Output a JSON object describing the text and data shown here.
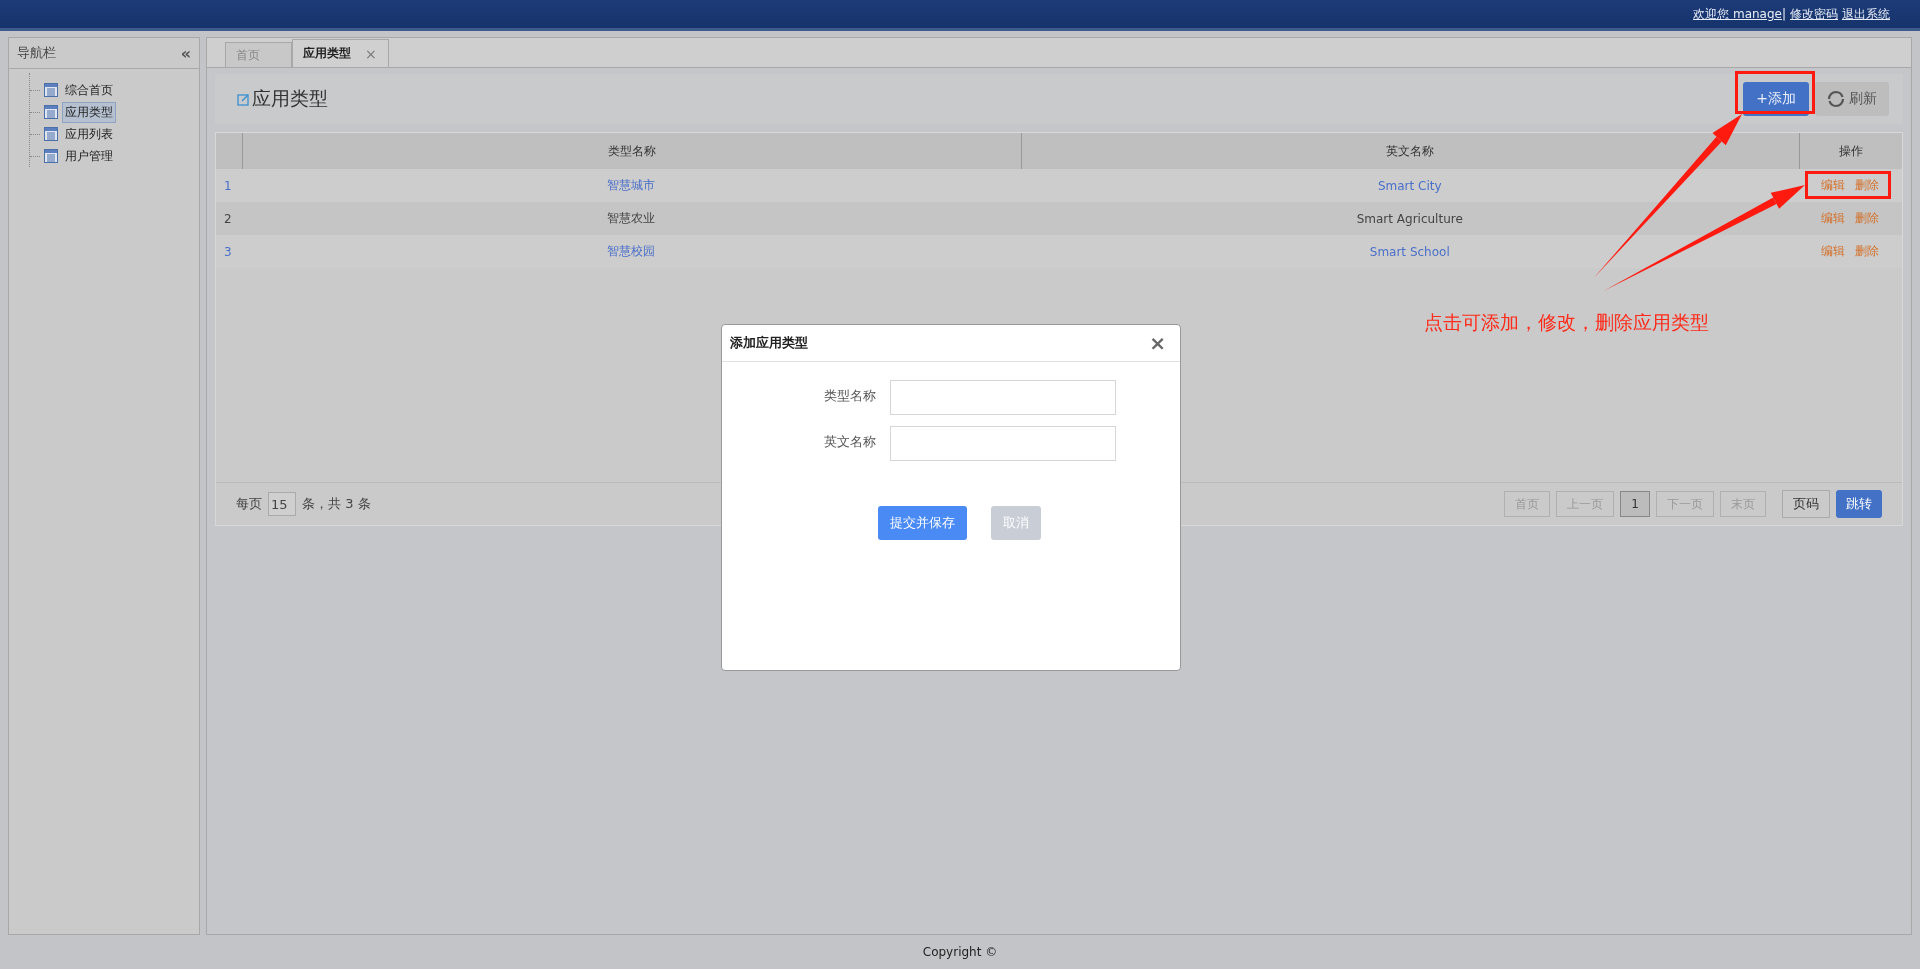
{
  "top_bar": {
    "links": [
      "欢迎您 manage|",
      "修改密码",
      "退出系统"
    ]
  },
  "sidebar": {
    "title": "导航栏",
    "collapse_glyph": "«",
    "items": [
      {
        "label": "综合首页",
        "selected": false
      },
      {
        "label": "应用类型",
        "selected": true
      },
      {
        "label": "应用列表",
        "selected": false
      },
      {
        "label": "用户管理",
        "selected": false
      }
    ]
  },
  "tabs": [
    {
      "label": "首页",
      "selected": false
    },
    {
      "label": "应用类型",
      "selected": true,
      "close_glyph": "×"
    }
  ],
  "page": {
    "title": "应用类型",
    "buttons": [
      {
        "kind": "primary",
        "label": "+添加"
      },
      {
        "kind": "refresh",
        "label": "刷新"
      }
    ]
  },
  "table": {
    "columns": [
      "类型名称",
      "英文名称",
      "操作"
    ],
    "rows": [
      {
        "index": "1",
        "name": "智慧城市",
        "english": "Smart City",
        "linked": true,
        "actions": [
          "编辑",
          "删除"
        ]
      },
      {
        "index": "2",
        "name": "智慧农业",
        "english": "Smart Agriculture",
        "linked": false,
        "actions": [
          "编辑",
          "删除"
        ]
      },
      {
        "index": "3",
        "name": "智慧校园",
        "english": "Smart School",
        "linked": true,
        "actions": [
          "编辑",
          "删除"
        ]
      }
    ]
  },
  "pagination": {
    "per_page_label": "每页",
    "per_page": "15",
    "total": "条，共 3 条",
    "pages": [
      {
        "label": "首页",
        "selected": false
      },
      {
        "label": "上一页",
        "selected": false
      },
      {
        "label": "1",
        "selected": true
      },
      {
        "label": "下一页",
        "selected": false
      },
      {
        "label": "末页",
        "selected": false
      }
    ],
    "page_code": "页码",
    "jump": "跳转"
  },
  "dialog": {
    "title": "添加应用类型",
    "close_glyph": "×",
    "fields": [
      {
        "label": "类型名称"
      },
      {
        "label": "英文名称"
      }
    ],
    "buttons": [
      {
        "kind": "primary",
        "label": "提交并保存"
      },
      {
        "kind": "muted",
        "label": "取消"
      }
    ]
  },
  "annotation": {
    "note": "点击可添加，修改，删除应用类型"
  },
  "footer": {
    "copyright": "Copyright ©"
  }
}
